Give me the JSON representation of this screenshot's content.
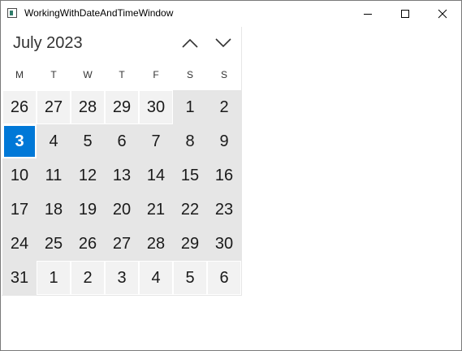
{
  "window": {
    "title": "WorkingWithDateAndTimeWindow"
  },
  "calendar": {
    "month_year": "July 2023",
    "weekdays": [
      "M",
      "T",
      "W",
      "T",
      "F",
      "S",
      "S"
    ],
    "today": "3",
    "days": [
      {
        "label": "26",
        "in_month": false
      },
      {
        "label": "27",
        "in_month": false
      },
      {
        "label": "28",
        "in_month": false
      },
      {
        "label": "29",
        "in_month": false
      },
      {
        "label": "30",
        "in_month": false
      },
      {
        "label": "1",
        "in_month": true
      },
      {
        "label": "2",
        "in_month": true
      },
      {
        "label": "3",
        "in_month": true,
        "today": true
      },
      {
        "label": "4",
        "in_month": true
      },
      {
        "label": "5",
        "in_month": true
      },
      {
        "label": "6",
        "in_month": true
      },
      {
        "label": "7",
        "in_month": true
      },
      {
        "label": "8",
        "in_month": true
      },
      {
        "label": "9",
        "in_month": true
      },
      {
        "label": "10",
        "in_month": true
      },
      {
        "label": "11",
        "in_month": true
      },
      {
        "label": "12",
        "in_month": true
      },
      {
        "label": "13",
        "in_month": true
      },
      {
        "label": "14",
        "in_month": true
      },
      {
        "label": "15",
        "in_month": true
      },
      {
        "label": "16",
        "in_month": true
      },
      {
        "label": "17",
        "in_month": true
      },
      {
        "label": "18",
        "in_month": true
      },
      {
        "label": "19",
        "in_month": true
      },
      {
        "label": "20",
        "in_month": true
      },
      {
        "label": "21",
        "in_month": true
      },
      {
        "label": "22",
        "in_month": true
      },
      {
        "label": "23",
        "in_month": true
      },
      {
        "label": "24",
        "in_month": true
      },
      {
        "label": "25",
        "in_month": true
      },
      {
        "label": "26",
        "in_month": true
      },
      {
        "label": "27",
        "in_month": true
      },
      {
        "label": "28",
        "in_month": true
      },
      {
        "label": "29",
        "in_month": true
      },
      {
        "label": "30",
        "in_month": true
      },
      {
        "label": "31",
        "in_month": true
      },
      {
        "label": "1",
        "in_month": false
      },
      {
        "label": "2",
        "in_month": false
      },
      {
        "label": "3",
        "in_month": false
      },
      {
        "label": "4",
        "in_month": false
      },
      {
        "label": "5",
        "in_month": false
      },
      {
        "label": "6",
        "in_month": false
      }
    ]
  },
  "colors": {
    "accent": "#0078d7",
    "in_month_bg": "#e6e6e6",
    "out_month_bg": "#f2f2f2"
  },
  "icons": {
    "minimize": "minimize-icon",
    "maximize": "maximize-icon",
    "close": "close-icon",
    "previous": "chevron-up-icon",
    "next": "chevron-down-icon"
  }
}
